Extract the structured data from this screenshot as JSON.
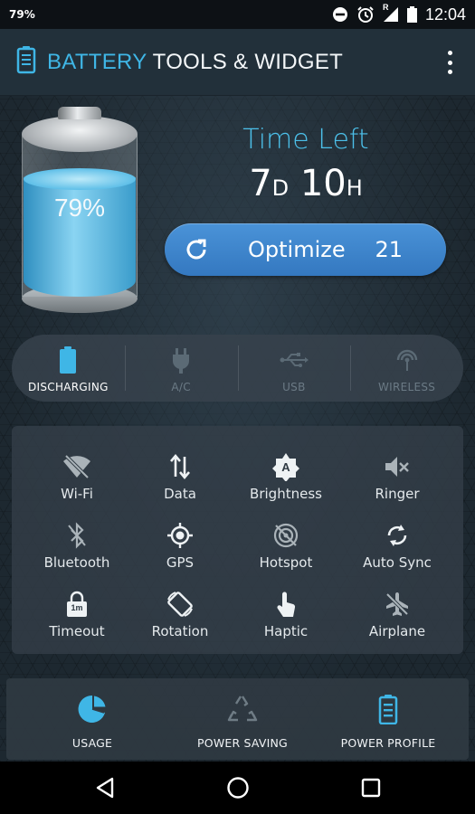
{
  "status_bar": {
    "left_text": "79%",
    "time": "12:04",
    "icons": [
      "do-not-disturb-icon",
      "alarm-icon",
      "signal-icon",
      "battery-icon"
    ],
    "roaming_letter": "R"
  },
  "app_bar": {
    "title_accent": "BATTERY",
    "title_rest": " TOOLS & WIDGET",
    "icon": "battery-icon",
    "menu_icon": "overflow-menu-icon"
  },
  "battery": {
    "percent_text": "79%",
    "level": 0.79
  },
  "time_left": {
    "label": "Time Left",
    "days": "7",
    "days_unit": "D",
    "hours": "10",
    "hours_unit": "H"
  },
  "optimize": {
    "label": "Optimize",
    "count": "21",
    "icon": "refresh-icon"
  },
  "power_sources": [
    {
      "label": "DISCHARGING",
      "icon": "battery-icon",
      "active": true
    },
    {
      "label": "A/C",
      "icon": "plug-icon",
      "active": false
    },
    {
      "label": "USB",
      "icon": "usb-icon",
      "active": false
    },
    {
      "label": "WIRELESS",
      "icon": "wireless-icon",
      "active": false
    }
  ],
  "toggles": [
    {
      "label": "Wi-Fi",
      "icon": "wifi-off-icon"
    },
    {
      "label": "Data",
      "icon": "data-arrows-icon"
    },
    {
      "label": "Brightness",
      "icon": "brightness-auto-icon"
    },
    {
      "label": "Ringer",
      "icon": "volume-off-icon"
    },
    {
      "label": "Bluetooth",
      "icon": "bluetooth-off-icon"
    },
    {
      "label": "GPS",
      "icon": "gps-icon"
    },
    {
      "label": "Hotspot",
      "icon": "hotspot-off-icon"
    },
    {
      "label": "Auto Sync",
      "icon": "sync-icon"
    },
    {
      "label": "Timeout",
      "icon": "lock-timeout-icon",
      "badge": "1m"
    },
    {
      "label": "Rotation",
      "icon": "rotation-icon"
    },
    {
      "label": "Haptic",
      "icon": "haptic-touch-icon"
    },
    {
      "label": "Airplane",
      "icon": "airplane-off-icon"
    }
  ],
  "bottom_nav": [
    {
      "label": "USAGE",
      "icon": "pie-chart-icon"
    },
    {
      "label": "POWER SAVING",
      "icon": "recycle-icon"
    },
    {
      "label": "POWER PROFILE",
      "icon": "battery-profile-icon"
    }
  ],
  "system_nav": [
    "back-icon",
    "home-icon",
    "recents-icon"
  ],
  "colors": {
    "accent": "#3fb6e6",
    "button": "#3f86cd",
    "background": "#1e2a33"
  }
}
